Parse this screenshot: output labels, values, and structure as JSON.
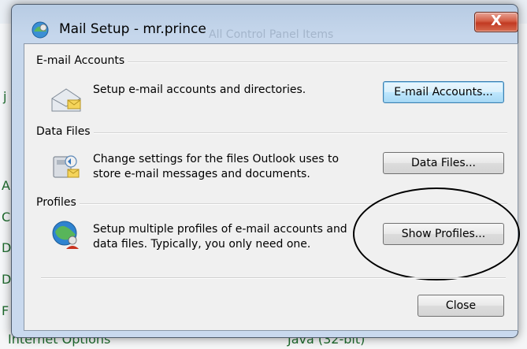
{
  "window": {
    "title": "Mail Setup - mr.prince",
    "background_title": "All Control Panel Items",
    "close_glyph": "X"
  },
  "background": {
    "partial_letters": [
      "j",
      "A",
      "C",
      "D",
      "D",
      "F"
    ],
    "bottom_left": "Internet Options",
    "bottom_right": "Java (32-bit)"
  },
  "sections": {
    "email_accounts": {
      "label": "E-mail Accounts",
      "description": "Setup e-mail accounts and directories.",
      "button": "E-mail Accounts...",
      "icon": "mail-accounts-icon"
    },
    "data_files": {
      "label": "Data Files",
      "description_line1": "Change settings for the files Outlook uses to",
      "description_line2": "store e-mail messages and documents.",
      "button": "Data Files...",
      "icon": "data-files-icon"
    },
    "profiles": {
      "label": "Profiles",
      "description_line1": "Setup multiple profiles of e-mail accounts and",
      "description_line2": "data files. Typically, you only need one.",
      "button": "Show Profiles...",
      "icon": "profiles-icon"
    }
  },
  "footer": {
    "close_button": "Close"
  },
  "colors": {
    "close_red": "#c23a22",
    "focus_blue": "#3c7fb1",
    "bg_link_green": "#1e6b2e"
  }
}
